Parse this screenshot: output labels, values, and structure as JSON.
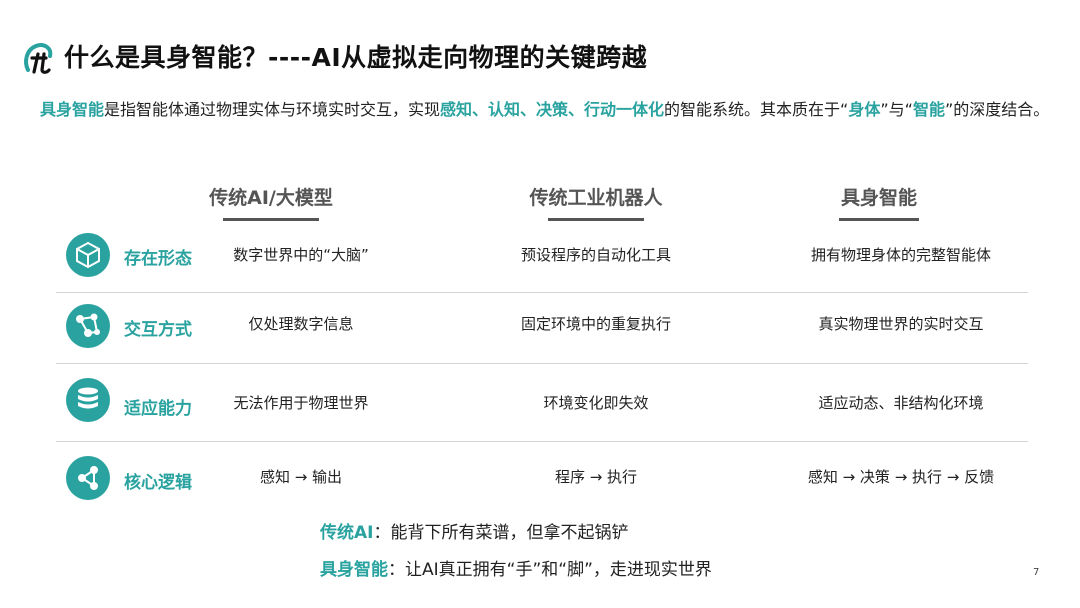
{
  "title": "什么是具身智能？----AI从虚拟走向物理的关键跨越",
  "intro": {
    "term": "具身智能",
    "text1": "是指智能体通过物理实体与环境实时交互，实现",
    "capabilities": "感知、认知、决策、行动一体化",
    "text2": "的智能系统。其本质在于“",
    "body": "身体",
    "text3": "”与“",
    "intelligence": "智能",
    "text4": "”的深度结合。"
  },
  "columns": [
    "传统AI/大模型",
    "传统工业机器人",
    "具身智能"
  ],
  "rows": [
    {
      "label": "存在形态",
      "icon": "cube-icon",
      "cells": [
        "数字世界中的“大脑”",
        "预设程序的自动化工具",
        "拥有物理身体的完整智能体"
      ]
    },
    {
      "label": "交互方式",
      "icon": "network-icon",
      "cells": [
        "仅处理数字信息",
        "固定环境中的重复执行",
        "真实物理世界的实时交互"
      ]
    },
    {
      "label": "适应能力",
      "icon": "database-icon",
      "cells": [
        "无法作用于物理世界",
        "环境变化即失效",
        "适应动态、非结构化环境"
      ]
    },
    {
      "label": "核心逻辑",
      "icon": "share-nodes-icon",
      "cells": [
        "感知 → 输出",
        "程序 → 执行",
        "感知 → 决策 → 执行 → 反馈"
      ]
    }
  ],
  "notes": [
    {
      "label": "传统AI",
      "text": "：能背下所有菜谱，但拿不起锅铲"
    },
    {
      "label": "具身智能",
      "text": "：让AI真正拥有“手”和“脚”，走进现实世界"
    }
  ],
  "page_number": "7",
  "colors": {
    "accent": "#2aa3a0",
    "heading_gray": "#555555"
  }
}
